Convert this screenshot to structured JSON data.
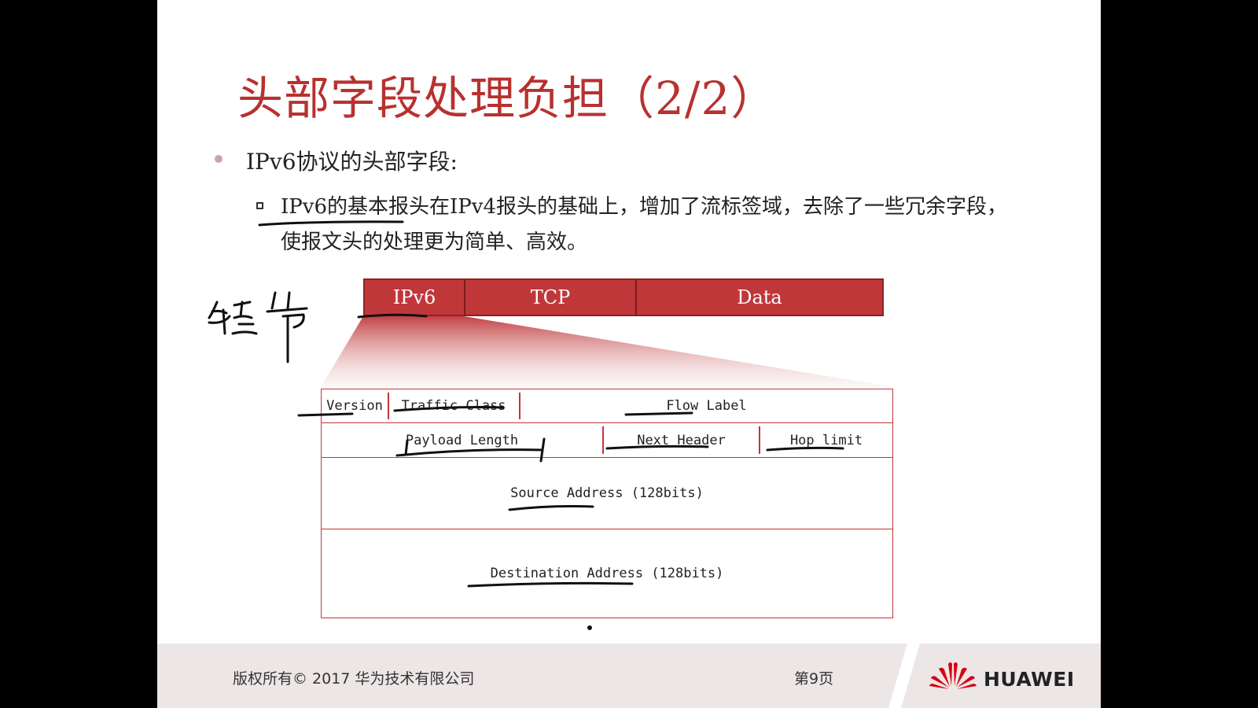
{
  "slide": {
    "title": "头部字段处理负担（2/2）",
    "bullet": "IPv6协议的头部字段:",
    "sub_line1": "IPv6的基本报头在IPv4报头的基础上，增加了流标签域，去除了一些冗余字段，",
    "sub_line2": "使报文头的处理更为简单、高效。"
  },
  "packet": {
    "ipv6": "IPv6",
    "tcp": "TCP",
    "data": "Data"
  },
  "header": {
    "version": "Version",
    "traffic_class": "Traffic Class",
    "flow_label": "Flow Label",
    "payload_length": "Payload Length",
    "next_header": "Next Header",
    "hop_limit": "Hop limit",
    "source_address": "Source Address (128bits)",
    "destination_address": "Destination Address (128bits)"
  },
  "footer": {
    "copyright": "版权所有© 2017 华为技术有限公司",
    "page": "第9页",
    "logo": "HUAWEI"
  },
  "colors": {
    "accent": "#c0373a",
    "title": "#b8312f",
    "footer_bg": "#ede6e6"
  }
}
